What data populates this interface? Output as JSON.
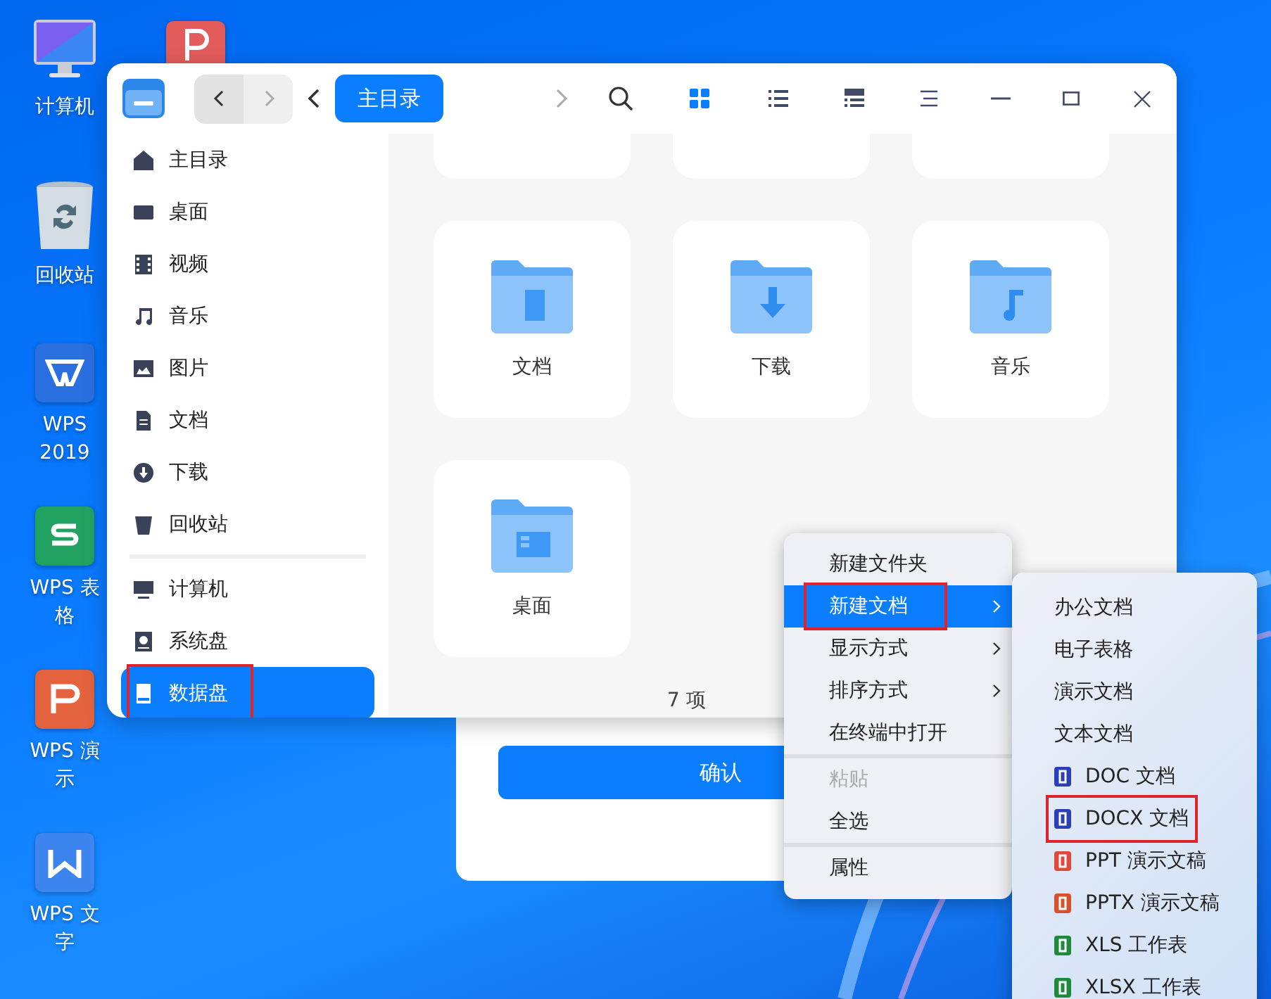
{
  "desktop_icons": [
    {
      "kind": "computer",
      "label": "计算机"
    },
    {
      "kind": "trash",
      "label": "回收站"
    },
    {
      "kind": "wps",
      "label": "WPS 2019"
    },
    {
      "kind": "sheet",
      "label": "WPS 表格"
    },
    {
      "kind": "slides",
      "label": "WPS 演示"
    },
    {
      "kind": "writer",
      "label": "WPS 文字"
    }
  ],
  "dialog": {
    "confirm_button": "确认"
  },
  "window": {
    "breadcrumb": "主目录",
    "view_modes": [
      {
        "kind": "grid",
        "selected": true
      },
      {
        "kind": "list",
        "selected": false
      },
      {
        "kind": "detail",
        "selected": false
      }
    ],
    "sidebar": {
      "groups": [
        [
          {
            "kind": "home",
            "label": "主目录",
            "selected": false,
            "marked": false
          },
          {
            "kind": "desktop",
            "label": "桌面",
            "selected": false,
            "marked": false
          },
          {
            "kind": "video",
            "label": "视频",
            "selected": false,
            "marked": false
          },
          {
            "kind": "music",
            "label": "音乐",
            "selected": false,
            "marked": false
          },
          {
            "kind": "picture",
            "label": "图片",
            "selected": false,
            "marked": false
          },
          {
            "kind": "document",
            "label": "文档",
            "selected": false,
            "marked": false
          },
          {
            "kind": "download",
            "label": "下载",
            "selected": false,
            "marked": false
          },
          {
            "kind": "trash",
            "label": "回收站",
            "selected": false,
            "marked": false
          }
        ],
        [
          {
            "kind": "computer",
            "label": "计算机",
            "selected": false,
            "marked": false
          },
          {
            "kind": "disk",
            "label": "系统盘",
            "selected": false,
            "marked": false
          },
          {
            "kind": "drive",
            "label": "数据盘",
            "selected": true,
            "marked": true
          }
        ]
      ]
    },
    "folders": [
      {
        "kind": "cut"
      },
      {
        "kind": "cut"
      },
      {
        "kind": "cut"
      },
      {
        "kind": "document",
        "label": "文档"
      },
      {
        "kind": "download",
        "label": "下载"
      },
      {
        "kind": "music",
        "label": "音乐"
      },
      {
        "kind": "desktop",
        "label": "桌面"
      }
    ],
    "item_count": "7 项"
  },
  "context_menu": {
    "groups": [
      [
        {
          "label": "新建文件夹",
          "submenu": false,
          "selected": false,
          "disabled": false,
          "marked": false
        },
        {
          "label": "新建文档",
          "submenu": true,
          "selected": true,
          "disabled": false,
          "marked": true
        },
        {
          "label": "显示方式",
          "submenu": true,
          "selected": false,
          "disabled": false,
          "marked": false
        },
        {
          "label": "排序方式",
          "submenu": true,
          "selected": false,
          "disabled": false,
          "marked": false
        },
        {
          "label": "在终端中打开",
          "submenu": false,
          "selected": false,
          "disabled": false,
          "marked": false
        }
      ],
      [
        {
          "label": "粘贴",
          "submenu": false,
          "selected": false,
          "disabled": true,
          "marked": false
        },
        {
          "label": "全选",
          "submenu": false,
          "selected": false,
          "disabled": false,
          "marked": false
        }
      ],
      [
        {
          "label": "属性",
          "submenu": false,
          "selected": false,
          "disabled": false,
          "marked": false
        }
      ]
    ]
  },
  "submenu": [
    {
      "label": "办公文档",
      "marked": false
    },
    {
      "label": "电子表格",
      "marked": false
    },
    {
      "label": "演示文档",
      "marked": false
    },
    {
      "label": "文本文档",
      "marked": false
    },
    {
      "label": "DOC 文档",
      "color": "#2b3fb8",
      "marked": false
    },
    {
      "label": "DOCX 文档",
      "color": "#2b3fb8",
      "marked": true
    },
    {
      "label": "PPT 演示文稿",
      "color": "#e0483c",
      "marked": false
    },
    {
      "label": "PPTX 演示文稿",
      "color": "#d9502c",
      "marked": false
    },
    {
      "label": "XLS 工作表",
      "color": "#1e8a3c",
      "marked": false
    },
    {
      "label": "XLSX 工作表",
      "color": "#1e8a3c",
      "marked": false
    }
  ]
}
